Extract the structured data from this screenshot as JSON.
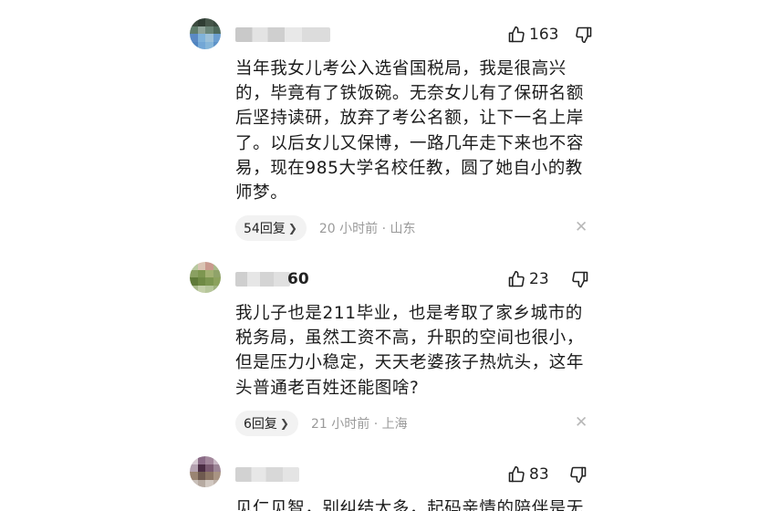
{
  "comments": [
    {
      "name_suffix": "",
      "likes": "163",
      "body": "当年我女儿考公入选省国税局，我是很高兴\n的，毕竟有了铁饭碗。无奈女儿有了保研名额\n后坚持读研，放弃了考公名额，让下一名上岸\n了。以后女儿又保博，一路几年走下来也不容\n易，现在985大学名校任教，圆了她自小的教\n师梦。",
      "replies": "54回复",
      "time": "20 小时前 · 山东"
    },
    {
      "name_suffix": "60",
      "likes": "23",
      "body": "我儿子也是211毕业，也是考取了家乡城市的\n税务局，虽然工资不高，升职的空间也很小，\n但是压力小稳定，天天老婆孩子热炕头，这年\n头普通老百姓还能图啥?",
      "replies": "6回复",
      "time": "21 小时前 · 上海"
    },
    {
      "name_suffix": "",
      "likes": "83",
      "body": "见仁见智，别纠结太多，起码亲情的陪伴是无"
    }
  ],
  "icons": {
    "like": "thumbs-up-icon",
    "dislike": "thumbs-down-icon",
    "close": "close-icon",
    "chevron": "chevron-right-icon"
  },
  "colors": {
    "meta": "#9a9a9a",
    "pill_bg": "#f2f2f2",
    "text": "#1b1b1b"
  }
}
